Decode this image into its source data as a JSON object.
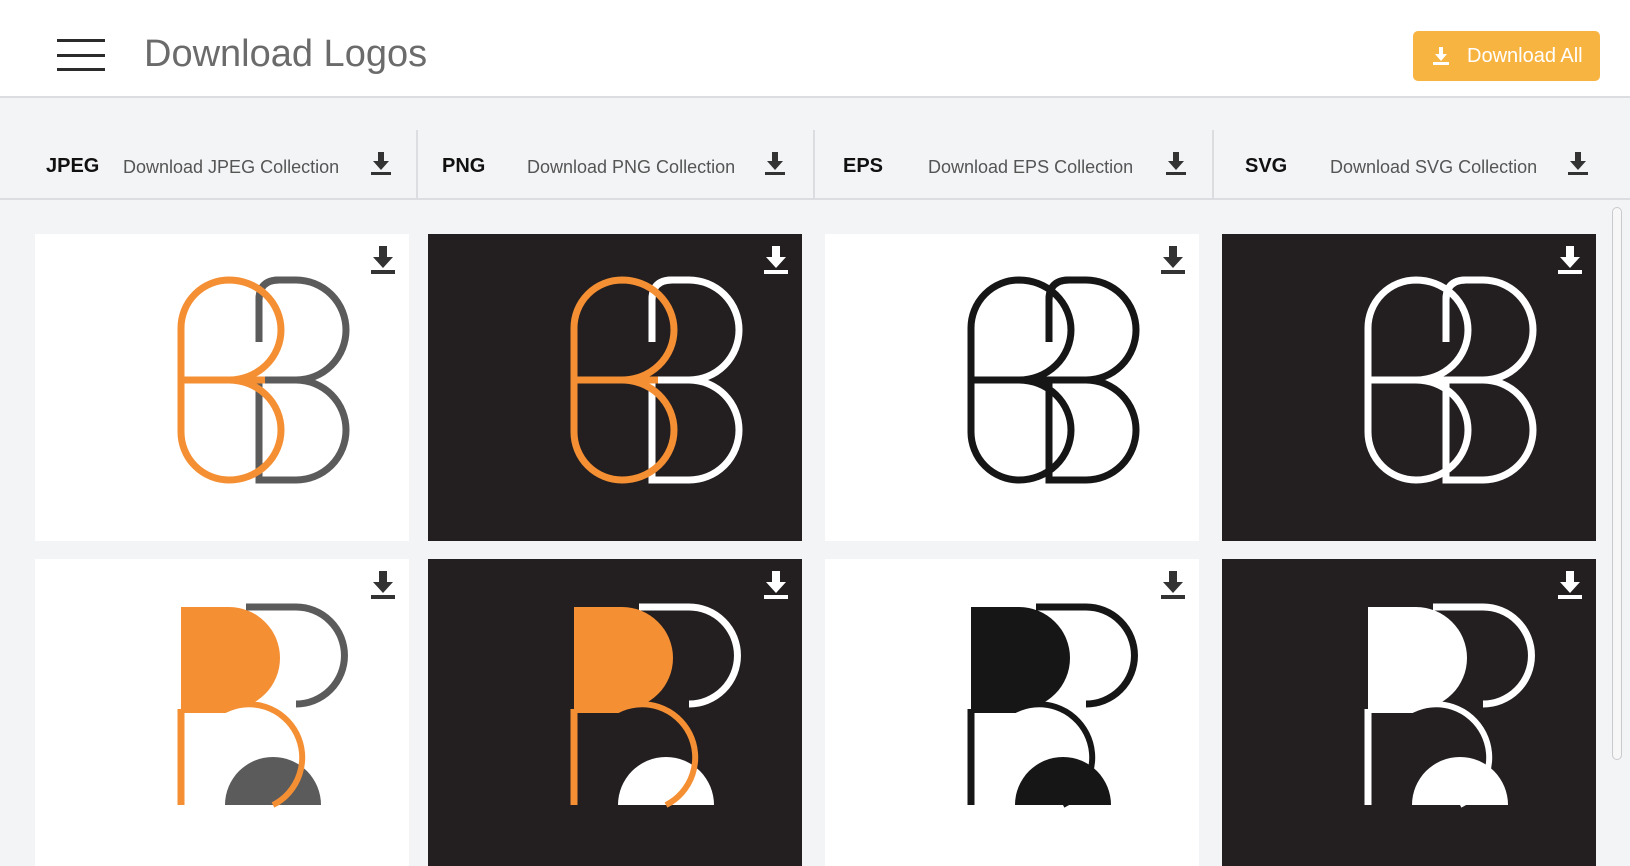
{
  "header": {
    "title": "Download Logos",
    "download_all_label": "Download All",
    "accent_color": "#f8b440"
  },
  "tabs": [
    {
      "format": "JPEG",
      "link": "Download JPEG Collection"
    },
    {
      "format": "PNG",
      "link": "Download PNG Collection"
    },
    {
      "format": "EPS",
      "link": "Download EPS Collection"
    },
    {
      "format": "SVG",
      "link": "Download SVG Collection"
    }
  ],
  "logo_cards": [
    {
      "variant": "outline",
      "background": "white",
      "colors": [
        "orange",
        "gray"
      ]
    },
    {
      "variant": "outline",
      "background": "black",
      "colors": [
        "orange",
        "white"
      ]
    },
    {
      "variant": "outline",
      "background": "white",
      "colors": [
        "black"
      ]
    },
    {
      "variant": "outline",
      "background": "black",
      "colors": [
        "white"
      ]
    },
    {
      "variant": "filled",
      "background": "white",
      "colors": [
        "orange",
        "gray"
      ]
    },
    {
      "variant": "filled",
      "background": "black",
      "colors": [
        "orange",
        "white"
      ]
    },
    {
      "variant": "filled",
      "background": "white",
      "colors": [
        "black"
      ]
    },
    {
      "variant": "filled",
      "background": "black",
      "colors": [
        "white"
      ]
    }
  ],
  "colors": {
    "orange": "#f58f33",
    "gray": "#5b5b5b",
    "black": "#161616",
    "white": "#ffffff",
    "dark_bg": "#231f20"
  },
  "icons": {
    "menu": "hamburger-icon",
    "download": "download-icon"
  }
}
